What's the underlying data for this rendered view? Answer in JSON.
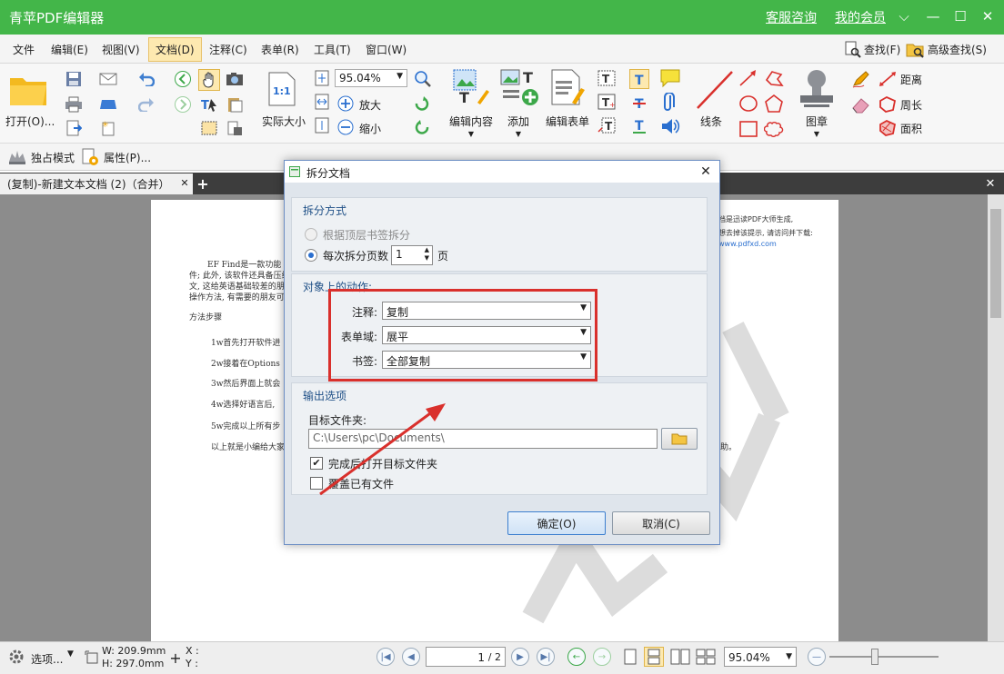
{
  "app": {
    "title": "青苹PDF编辑器",
    "service_link": "客服咨询",
    "member_link": "我的会员"
  },
  "menu": [
    "文件",
    "编辑(E)",
    "视图(V)",
    "文档(D)",
    "注释(C)",
    "表单(R)",
    "工具(T)",
    "窗口(W)"
  ],
  "menu_right": {
    "find": "查找(F)",
    "advanced_find": "高级查找(S)"
  },
  "toolbar": {
    "open": "打开(O)...",
    "zoom": "95.04%",
    "actual_size": "实际大小",
    "zoom_in": "放大",
    "zoom_out": "缩小",
    "edit_content": "编辑内容",
    "add": "添加",
    "edit_form": "编辑表单",
    "lines": "线条",
    "stamp": "图章",
    "distance": "距离",
    "perimeter": "周长",
    "area": "面积"
  },
  "modebar": {
    "exclusive": "独占模式",
    "properties": "属性(P)..."
  },
  "tab": {
    "label": "(复制)-新建文本文档 (2)（合并）"
  },
  "document": {
    "lines": [
      "EF Find是一款功能",
      "件; 此外, 该软件还具备压缩文",
      "文, 这给英语基础较差的朋友们",
      "操作方法, 有需要的朋友可以看",
      "方法步骤",
      "1w首先打开软件进",
      "2w接着在Options",
      "3w然后界面上就会",
      "4w选择好语言后,",
      "5w完成以上所有步",
      "以上就是小编给大家"
    ],
    "right_lines": [
      "档是迅读PDF大师生成,",
      "想去掉该提示, 请访问并下载:",
      "www.pdfxd.com"
    ],
    "end_fragment": "助。"
  },
  "dialog": {
    "title": "拆分文档",
    "split_group": "拆分方式",
    "by_bookmark": "根据顶层书签拆分",
    "per_pages": "每次拆分页数",
    "pages_value": "1",
    "pages_unit": "页",
    "actions_group": "对象上的动作:",
    "comments_label": "注释:",
    "comments_value": "复制",
    "forms_label": "表单域:",
    "forms_value": "展平",
    "bookmarks_label": "书签:",
    "bookmarks_value": "全部复制",
    "output_group": "输出选项",
    "target_folder_label": "目标文件夹:",
    "target_folder_value": "C:\\Users\\pc\\Documents\\",
    "open_after": "完成后打开目标文件夹",
    "overwrite": "覆盖已有文件",
    "ok": "确定(O)",
    "cancel": "取消(C)"
  },
  "status": {
    "options": "选项...",
    "width": "W: 209.9mm",
    "height": "H: 297.0mm",
    "x": "X :",
    "y": "Y :",
    "page_value": "1",
    "page_total": "/ 2",
    "zoom": "95.04%"
  },
  "colors": {
    "titlebar": "#43b649",
    "highlight": "#d9302c",
    "accent_blue": "#1e4f86"
  }
}
